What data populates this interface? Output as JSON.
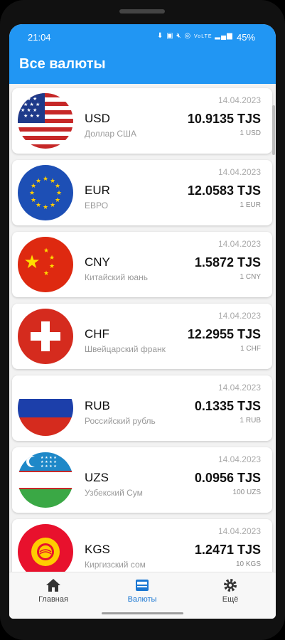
{
  "status_bar": {
    "time": "21:04",
    "icons": [
      "download-icon",
      "image-icon",
      "mute-icon",
      "hotspot-icon",
      "volte-icon",
      "signal-icon"
    ],
    "volte_text": "VoLTE",
    "battery": "45%"
  },
  "app_bar": {
    "title": "Все валюты"
  },
  "currencies": [
    {
      "code": "USD",
      "name": "Доллар США",
      "date": "14.04.2023",
      "rate": "10.9135 TJS",
      "unit": "1 USD",
      "flag": "us-flag"
    },
    {
      "code": "EUR",
      "name": "ЕВРО",
      "date": "14.04.2023",
      "rate": "12.0583 TJS",
      "unit": "1 EUR",
      "flag": "eu-flag"
    },
    {
      "code": "CNY",
      "name": "Китайский юань",
      "date": "14.04.2023",
      "rate": "1.5872 TJS",
      "unit": "1 CNY",
      "flag": "cn-flag"
    },
    {
      "code": "CHF",
      "name": "Швейцарский франк",
      "date": "14.04.2023",
      "rate": "12.2955 TJS",
      "unit": "1 CHF",
      "flag": "ch-flag"
    },
    {
      "code": "RUB",
      "name": "Российский рубль",
      "date": "14.04.2023",
      "rate": "0.1335 TJS",
      "unit": "1 RUB",
      "flag": "ru-flag"
    },
    {
      "code": "UZS",
      "name": "Узбекский Сум",
      "date": "14.04.2023",
      "rate": "0.0956 TJS",
      "unit": "100 UZS",
      "flag": "uz-flag"
    },
    {
      "code": "KGS",
      "name": "Киргизский сом",
      "date": "14.04.2023",
      "rate": "1.2471 TJS",
      "unit": "10 KGS",
      "flag": "kg-flag"
    }
  ],
  "bottom_nav": [
    {
      "label": "Главная",
      "icon": "home-icon",
      "active": false
    },
    {
      "label": "Валюты",
      "icon": "currency-icon",
      "active": true
    },
    {
      "label": "Ещё",
      "icon": "gear-icon",
      "active": false
    }
  ],
  "colors": {
    "primary": "#2196f3",
    "active_nav": "#1976d2"
  }
}
